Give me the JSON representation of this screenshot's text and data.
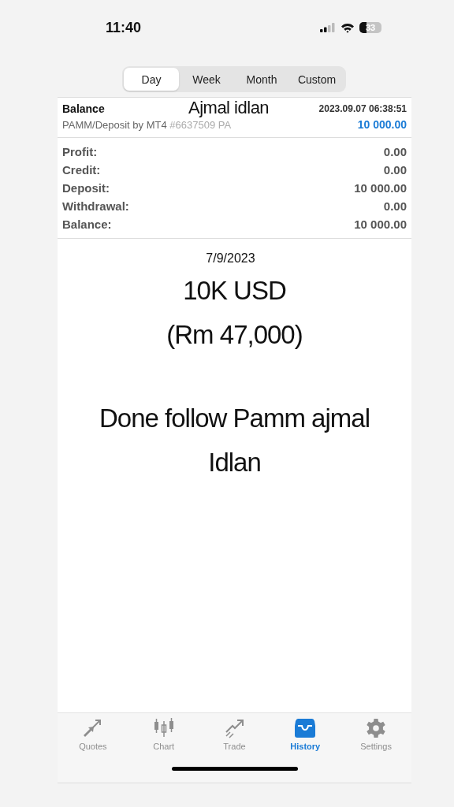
{
  "status_bar": {
    "time": "11:40",
    "battery": "33"
  },
  "periods": [
    {
      "label": "Day",
      "selected": true
    },
    {
      "label": "Week",
      "selected": false
    },
    {
      "label": "Month",
      "selected": false
    },
    {
      "label": "Custom",
      "selected": false
    }
  ],
  "entry": {
    "title": "Balance",
    "overlay_name": "Ajmal idlan",
    "datetime": "2023.09.07 06:38:51",
    "comment": "PAMM/Deposit by MT4",
    "ticket": "#6637509 PA",
    "amount": "10 000.00"
  },
  "summary": [
    {
      "label": "Profit:",
      "value": "0.00"
    },
    {
      "label": "Credit:",
      "value": "0.00"
    },
    {
      "label": "Deposit:",
      "value": "10 000.00"
    },
    {
      "label": "Withdrawal:",
      "value": "0.00"
    },
    {
      "label": "Balance:",
      "value": "10 000.00"
    }
  ],
  "caption": {
    "date": "7/9/2023",
    "amount": "10K USD",
    "converted": "(Rm 47,000)",
    "note_lines": [
      "Done follow Pamm ajmal",
      "Idlan"
    ]
  },
  "tab_bar": [
    {
      "label": "Quotes",
      "kind": "quotes",
      "selected": false
    },
    {
      "label": "Chart",
      "kind": "chart",
      "selected": false
    },
    {
      "label": "Trade",
      "kind": "trade",
      "selected": false
    },
    {
      "label": "History",
      "kind": "history",
      "selected": true
    },
    {
      "label": "Settings",
      "kind": "settings",
      "selected": false
    }
  ]
}
